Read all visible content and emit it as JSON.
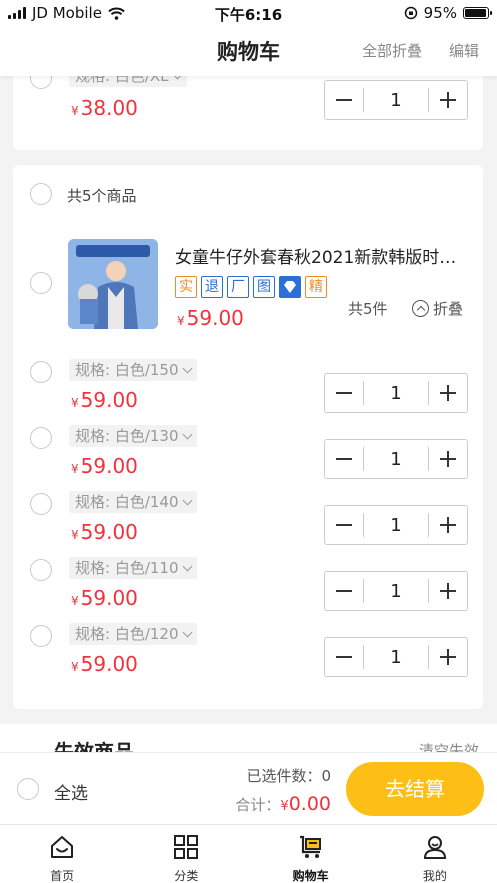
{
  "status_bar": {
    "carrier": "JD Mobile",
    "time": "下午6:16",
    "battery": "95%",
    "battery_level": 0.95
  },
  "header": {
    "title": "购物车",
    "collapse_all": "全部折叠",
    "edit": "编辑"
  },
  "top_partial_item": {
    "spec": "规格: 白色/XL",
    "currency": "¥",
    "price": "38.00",
    "quantity": "1"
  },
  "group": {
    "summary": "共5个商品",
    "product_title": "女童牛仔外套春秋2021新款韩版时…",
    "tags": [
      "实",
      "退",
      "厂",
      "图",
      "",
      "精"
    ],
    "currency": "¥",
    "price": "59.00",
    "count_text": "共5件",
    "fold_label": "折叠",
    "variants": [
      {
        "spec": "规格: 白色/150",
        "price": "59.00",
        "quantity": "1"
      },
      {
        "spec": "规格: 白色/130",
        "price": "59.00",
        "quantity": "1"
      },
      {
        "spec": "规格: 白色/140",
        "price": "59.00",
        "quantity": "1"
      },
      {
        "spec": "规格: 白色/110",
        "price": "59.00",
        "quantity": "1"
      },
      {
        "spec": "规格: 白色/120",
        "price": "59.00",
        "quantity": "1"
      }
    ]
  },
  "invalid_section": {
    "title": "失效商品",
    "clear": "清空失效"
  },
  "checkout": {
    "select_all": "全选",
    "selected_label": "已选件数：",
    "selected_count": "0",
    "total_label": "合计：",
    "currency": "¥",
    "total": "0.00",
    "button": "去结算",
    "button_color": "#fdbf16",
    "price_color": "#f0323c"
  },
  "tabbar": {
    "items": [
      {
        "label": "首页",
        "icon": "home-icon"
      },
      {
        "label": "分类",
        "icon": "category-grid-icon"
      },
      {
        "label": "购物车",
        "icon": "cart-icon",
        "active": true
      },
      {
        "label": "我的",
        "icon": "user-icon"
      }
    ]
  }
}
